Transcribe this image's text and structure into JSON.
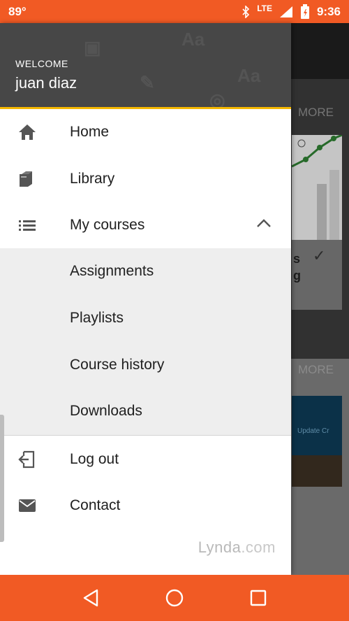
{
  "status_bar": {
    "temperature": "89°",
    "network": "LTE",
    "time": "9:36"
  },
  "background": {
    "more_label_1": "MORE",
    "more_label_2": "MORE",
    "card_text_1": "s",
    "card_text_2": "g",
    "thumb_label": "Update   Cr"
  },
  "drawer": {
    "welcome": "WELCOME",
    "username": "juan diaz",
    "items": [
      {
        "label": "Home",
        "icon": "home-icon"
      },
      {
        "label": "Library",
        "icon": "library-icon"
      },
      {
        "label": "My courses",
        "icon": "list-icon"
      }
    ],
    "submenu": [
      {
        "label": "Assignments"
      },
      {
        "label": "Playlists"
      },
      {
        "label": "Course history"
      },
      {
        "label": "Downloads"
      }
    ],
    "footer_items": [
      {
        "label": "Log out",
        "icon": "logout-icon"
      },
      {
        "label": "Contact",
        "icon": "mail-icon"
      }
    ],
    "brand_name": "Lynda",
    "brand_domain": ".com"
  },
  "colors": {
    "accent": "#f15a24",
    "header_bg": "#474747",
    "header_underline": "#f5b800"
  }
}
